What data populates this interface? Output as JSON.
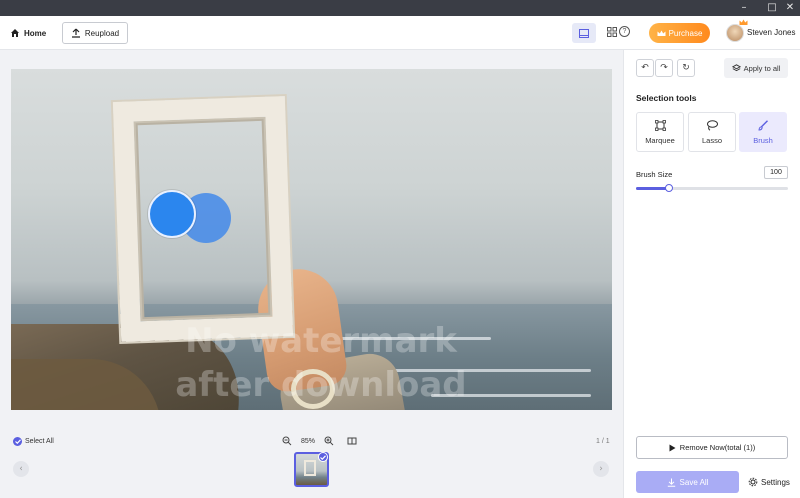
{
  "window": {
    "minimize": "–",
    "maximize": "□",
    "close": "✕"
  },
  "toolbar": {
    "home_label": "Home",
    "reupload_label": "Reupload",
    "help_glyph": "?",
    "purchase_label": "Purchase",
    "user_name": "Steven Jones"
  },
  "canvas": {
    "watermark_line1": "No watermark",
    "watermark_line2": "after download"
  },
  "bottom": {
    "select_all_label": "Select All",
    "zoom_level": "85%",
    "page_count": "1 / 1",
    "prev_arrow": "‹",
    "next_arrow": "›"
  },
  "panel": {
    "undo_glyph": "↶",
    "redo_glyph": "↷",
    "reset_glyph": "↻",
    "apply_all_label": "Apply to all",
    "selection_tools_title": "Selection tools",
    "tools": [
      {
        "label": "Marquee",
        "icon": "marquee-icon",
        "active": false
      },
      {
        "label": "Lasso",
        "icon": "lasso-icon",
        "active": false
      },
      {
        "label": "Brush",
        "icon": "brush-icon",
        "active": true
      }
    ],
    "brush_size_label": "Brush Size",
    "brush_size_value": "100",
    "brush_size_fraction": 0.22,
    "remove_label": "Remove Now(total (1))",
    "save_all_label": "Save All",
    "settings_label": "Settings"
  },
  "colors": {
    "accent": "#5b5fe0",
    "purchase": "#ff9a2e",
    "brush": "#2b86ee"
  }
}
